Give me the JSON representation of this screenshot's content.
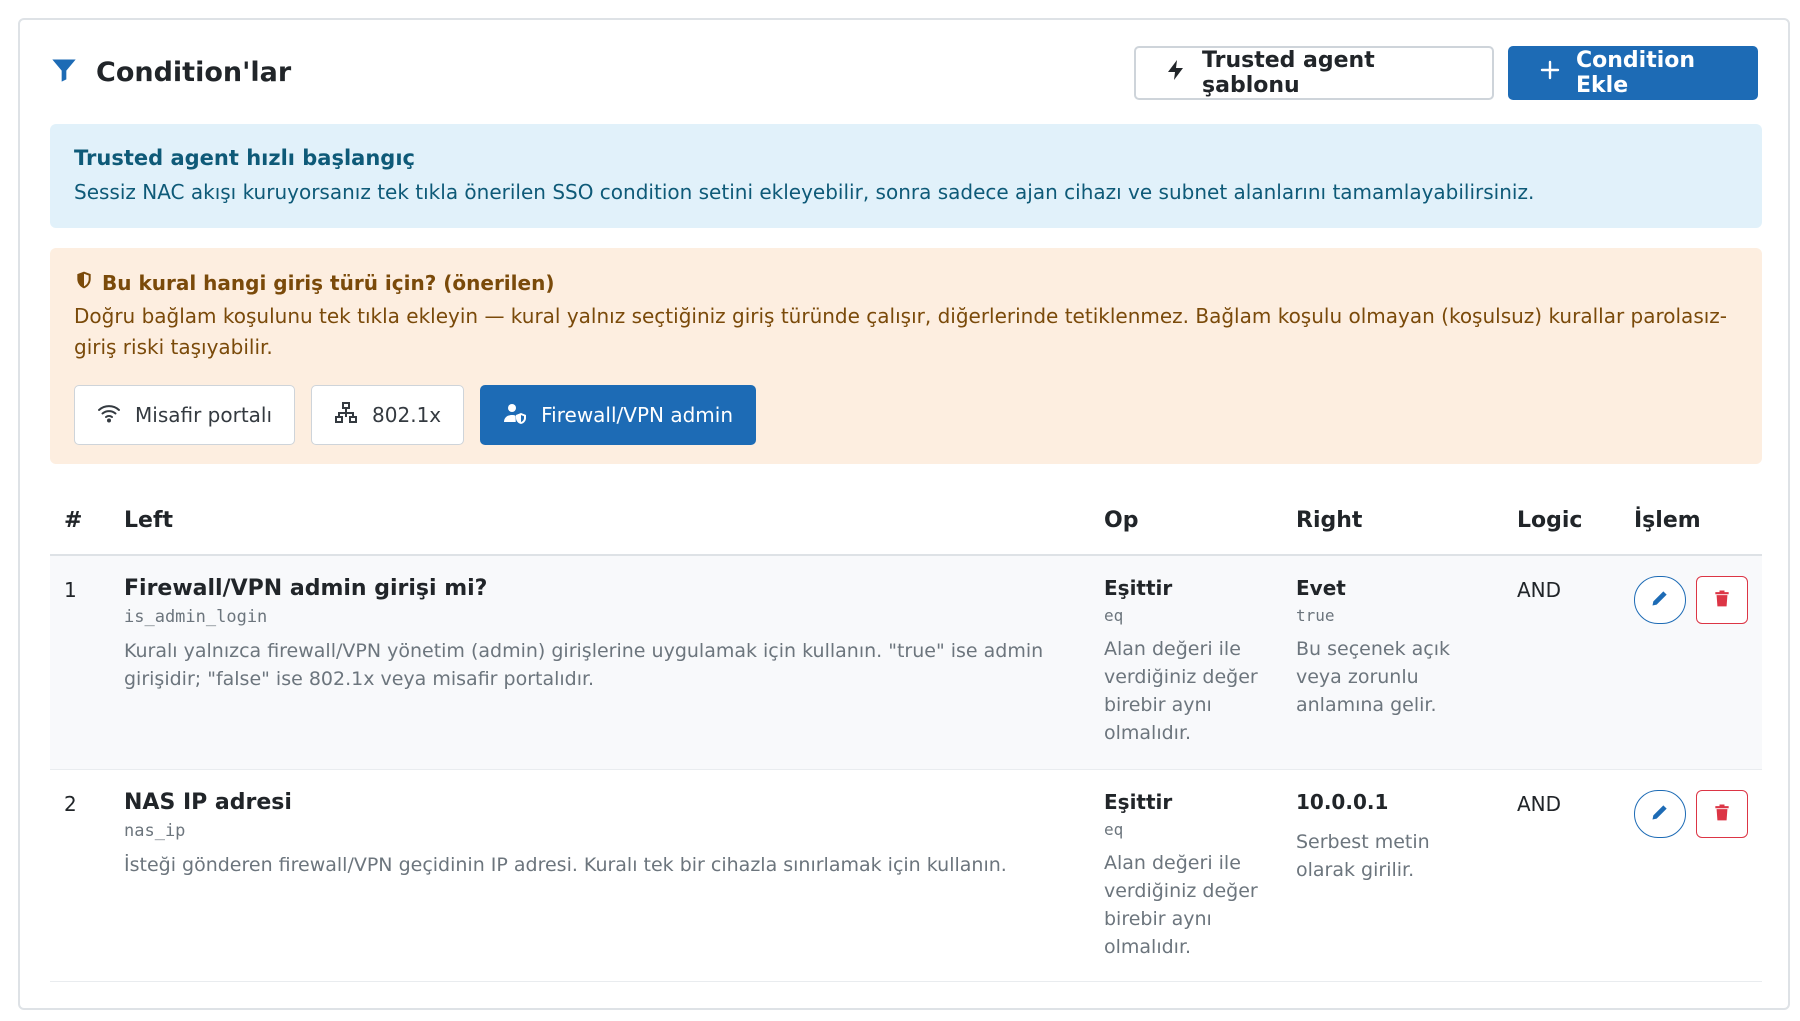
{
  "header": {
    "title": "Condition'lar",
    "template_button": "Trusted agent şablonu",
    "add_button": "Condition Ekle"
  },
  "info_alert": {
    "title": "Trusted agent hızlı başlangıç",
    "text": "Sessiz NAC akışı kuruyorsanız tek tıkla önerilen SSO condition setini ekleyebilir, sonra sadece ajan cihazı ve subnet alanlarını tamamlayabilirsiniz."
  },
  "context_alert": {
    "title": "Bu kural hangi giriş türü için? (önerilen)",
    "text": "Doğru bağlam koşulunu tek tıkla ekleyin — kural yalnız seçtiğiniz giriş türünde çalışır, diğerlerinde tetiklenmez. Bağlam koşulu olmayan (koşulsuz) kurallar parolasız-giriş riski taşıyabilir.",
    "options": [
      "Misafir portalı",
      "802.1x",
      "Firewall/VPN admin"
    ],
    "selected": "Firewall/VPN admin"
  },
  "table": {
    "headers": {
      "num": "#",
      "left": "Left",
      "op": "Op",
      "right": "Right",
      "logic": "Logic",
      "action": "İşlem"
    },
    "rows": [
      {
        "num": "1",
        "field_name": "Firewall/VPN admin girişi mi?",
        "field_code": "is_admin_login",
        "field_desc": "Kuralı yalnızca firewall/VPN yönetim (admin) girişlerine uygulamak için kullanın. \"true\" ise admin girişidir; \"false\" ise 802.1x veya misafir portalıdır.",
        "op_name": "Eşittir",
        "op_code": "eq",
        "op_desc": "Alan değeri ile verdiğiniz değer birebir aynı olmalıdır.",
        "right_name": "Evet",
        "right_code": "true",
        "right_desc": "Bu seçenek açık veya zorunlu anlamına gelir.",
        "logic": "AND"
      },
      {
        "num": "2",
        "field_name": "NAS IP adresi",
        "field_code": "nas_ip",
        "field_desc": "İsteği gönderen firewall/VPN geçidinin IP adresi. Kuralı tek bir cihazla sınırlamak için kullanın.",
        "op_name": "Eşittir",
        "op_code": "eq",
        "op_desc": "Alan değeri ile verdiğiniz değer birebir aynı olmalıdır.",
        "right_name": "10.0.0.1",
        "right_code": "",
        "right_desc": "Serbest metin olarak girilir.",
        "logic": "AND"
      }
    ]
  },
  "colors": {
    "primary": "#1d6bb5",
    "danger": "#dc3545",
    "info_bg": "#e1f1fa",
    "warn_bg": "#fdeee0"
  }
}
